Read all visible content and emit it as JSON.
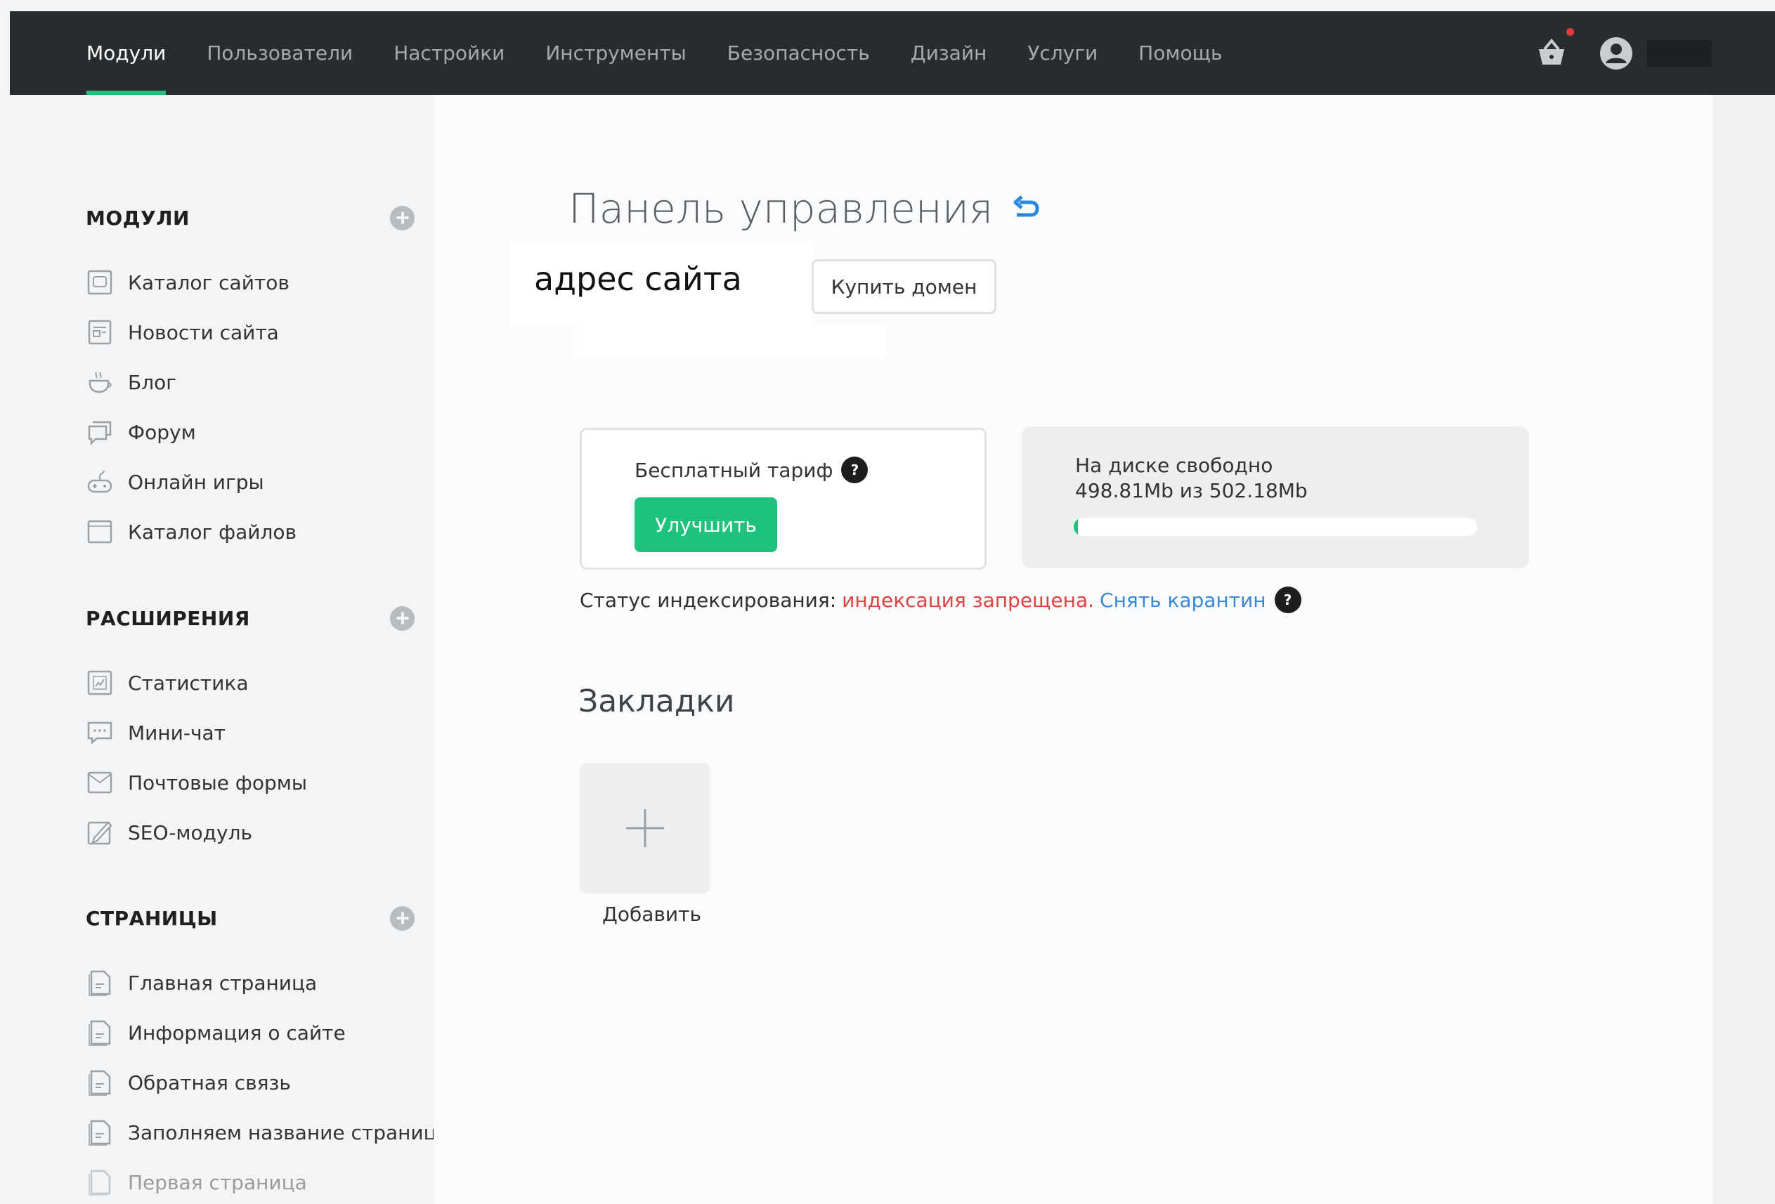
{
  "nav": {
    "items": [
      {
        "label": "Модули",
        "active": true
      },
      {
        "label": "Пользователи"
      },
      {
        "label": "Настройки"
      },
      {
        "label": "Инструменты"
      },
      {
        "label": "Безопасность"
      },
      {
        "label": "Дизайн"
      },
      {
        "label": "Услуги"
      },
      {
        "label": "Помощь"
      }
    ],
    "icons": [
      "basket-icon",
      "user-icon"
    ]
  },
  "sidebar": {
    "modules": {
      "title": "МОДУЛИ",
      "items": [
        {
          "label": "Каталог сайтов",
          "icon": "catalog-icon"
        },
        {
          "label": "Новости сайта",
          "icon": "news-icon"
        },
        {
          "label": "Блог",
          "icon": "cup-icon"
        },
        {
          "label": "Форум",
          "icon": "forum-icon"
        },
        {
          "label": "Онлайн игры",
          "icon": "gamepad-icon"
        },
        {
          "label": "Каталог файлов",
          "icon": "files-icon"
        }
      ]
    },
    "extensions": {
      "title": "РАСШИРЕНИЯ",
      "items": [
        {
          "label": "Статистика",
          "icon": "stats-icon"
        },
        {
          "label": "Мини-чат",
          "icon": "chat-icon"
        },
        {
          "label": "Почтовые формы",
          "icon": "mail-icon"
        },
        {
          "label": "SEO-модуль",
          "icon": "seo-icon"
        }
      ]
    },
    "pages": {
      "title": "СТРАНИЦЫ",
      "items": [
        {
          "label": "Главная страница",
          "icon": "page-icon"
        },
        {
          "label": "Информация о сайте",
          "icon": "page-icon"
        },
        {
          "label": "Обратная связь",
          "icon": "page-icon"
        },
        {
          "label": "Заполняем название странице",
          "icon": "page-icon"
        },
        {
          "label": "Первая страница",
          "icon": "page-icon"
        }
      ]
    }
  },
  "main": {
    "title": "Панель управления",
    "address_text": "адрес   сайта",
    "buy_domain_label": "Купить домен",
    "tariff": {
      "label": "Бесплатный тариф",
      "help": "?",
      "upgrade_label": "Улучшить"
    },
    "disk": {
      "line1": "На диске свободно",
      "line2": "498.81Mb из 502.18Mb",
      "used_fraction": 0.007
    },
    "indexing": {
      "label": "Статус индексирования:",
      "status": "индексация запрещена.",
      "link": "Снять карантин",
      "help": "?"
    },
    "bookmarks": {
      "title": "Закладки",
      "add_label": "Добавить"
    }
  },
  "colors": {
    "accent": "#1dc27d",
    "topbar": "#292c2f",
    "error": "#e04141",
    "link": "#3a86d8"
  }
}
